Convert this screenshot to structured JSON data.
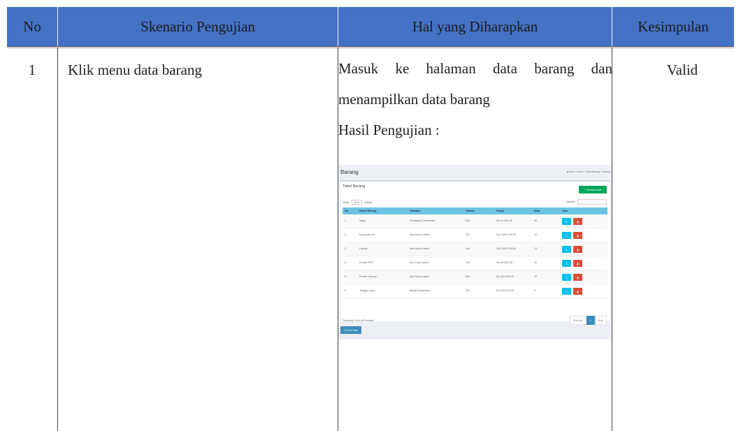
{
  "table": {
    "headers": [
      "No",
      "Skenario Pengujian",
      "Hal yang Diharapkan",
      "Kesimpulan"
    ],
    "header_color": "#4472c4",
    "row": {
      "no": "1",
      "scenario": "Klik menu data barang",
      "expected_line1": "Masuk ke halaman data barang dan",
      "expected_line2": "menampilkan data barang",
      "result_label": "Hasil Pengujian :",
      "conclusion": "Valid"
    }
  },
  "screenshot": {
    "page_title": "Barang",
    "breadcrumb": "Menu Utama  ›  Data Barang  ›  Barang",
    "box_title": "Tabel Barang",
    "add_button": "+ Tambah Data",
    "show_label": "Show",
    "show_value": "10",
    "entries_label": "entries",
    "search_label": "Search:",
    "columns": [
      "No",
      "Nama Barang",
      "Kategori",
      "Satuan",
      "Harga",
      "Stok",
      "Aksi"
    ],
    "rows": [
      [
        "1",
        "Sapu",
        "Peralatan Kebersihan",
        "Pcs",
        "Rp 10.000,00",
        "45"
      ],
      [
        "2",
        "Komputer LG",
        "Alat Kerja Kantor",
        "Set",
        "Rp 3.000.000,00",
        "10"
      ],
      [
        "3",
        "Laptop",
        "Alat Kerja Kantor",
        "Set",
        "Rp 2.000.000,00",
        "13"
      ],
      [
        "4",
        "Kertas HVS",
        "Alat Tulis Kantor",
        "Pcs",
        "Rp 45.000,00",
        "20"
      ],
      [
        "5",
        "Printer Cannon",
        "Alat Kerja Kantor",
        "Set",
        "Rp 900.000,00",
        "19"
      ],
      [
        "6",
        "Tangga Lipat",
        "Bahan Bangunan",
        "Set",
        "Rp 200.000,00",
        "5"
      ]
    ],
    "edit_icon": "pencil-icon",
    "delete_icon": "trash-icon",
    "info": "Showing 1 to 6 of 6 entries",
    "pager": [
      "Previous",
      "1",
      "Next"
    ],
    "print_button": "Print Data",
    "colors": {
      "add": "#00a65a",
      "edit": "#00c0ef",
      "delete": "#dd4b39",
      "head": "#6cc3e5",
      "primary": "#3c8dbc"
    }
  }
}
